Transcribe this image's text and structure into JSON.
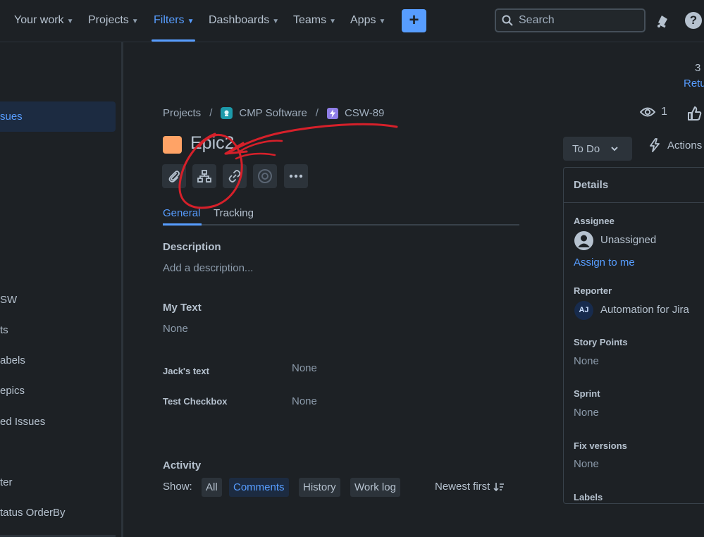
{
  "nav": {
    "items": [
      {
        "label": "Your work",
        "active": false
      },
      {
        "label": "Projects",
        "active": false
      },
      {
        "label": "Filters",
        "active": true
      },
      {
        "label": "Dashboards",
        "active": false
      },
      {
        "label": "Teams",
        "active": false
      },
      {
        "label": "Apps",
        "active": false
      }
    ],
    "create_label": "+",
    "search_placeholder": "Search",
    "help_label": "?"
  },
  "sidebar": {
    "items": [
      {
        "label": "sues",
        "active": true
      },
      {
        "label": "SW",
        "active": false
      },
      {
        "label": "ts",
        "active": false
      },
      {
        "label": "abels",
        "active": false
      },
      {
        "label": "epics",
        "active": false
      },
      {
        "label": "ed Issues",
        "active": false
      },
      {
        "label": "ter",
        "active": false
      },
      {
        "label": "tatus OrderBy",
        "active": false
      }
    ]
  },
  "header": {
    "page_num": "3",
    "return_label": "Retu"
  },
  "breadcrumb": {
    "projects": "Projects",
    "project": "CMP Software",
    "issue_key": "CSW-89"
  },
  "watchers": "1",
  "issue": {
    "title": "Epic2",
    "color": "#ffa366"
  },
  "toolbar": [
    "paperclip-icon",
    "child-issues-icon",
    "link-icon",
    "target-icon",
    "more-icon"
  ],
  "tabs": [
    {
      "label": "General",
      "active": true
    },
    {
      "label": "Tracking",
      "active": false
    }
  ],
  "fields": {
    "description_label": "Description",
    "description_placeholder": "Add a description...",
    "my_text_label": "My Text",
    "my_text_value": "None",
    "jacks_text_label": "Jack's text",
    "jacks_text_value": "None",
    "checkbox_label": "Test Checkbox",
    "checkbox_value": "None"
  },
  "activity": {
    "title": "Activity",
    "show_label": "Show:",
    "filters": [
      {
        "label": "All",
        "active": false
      },
      {
        "label": "Comments",
        "active": true
      },
      {
        "label": "History",
        "active": false
      },
      {
        "label": "Work log",
        "active": false
      }
    ],
    "sort_label": "Newest first"
  },
  "status": {
    "label": "To Do",
    "actions_label": "Actions"
  },
  "details": {
    "title": "Details",
    "assignee_label": "Assignee",
    "assignee_value": "Unassigned",
    "assign_link": "Assign to me",
    "reporter_label": "Reporter",
    "reporter_initials": "AJ",
    "reporter_value": "Automation for Jira",
    "story_points_label": "Story Points",
    "story_points_value": "None",
    "sprint_label": "Sprint",
    "sprint_value": "None",
    "fix_versions_label": "Fix versions",
    "fix_versions_value": "None",
    "labels_label": "Labels"
  },
  "colors": {
    "accent": "#579dff",
    "background": "#1d2125",
    "annotation": "#d6202a"
  }
}
